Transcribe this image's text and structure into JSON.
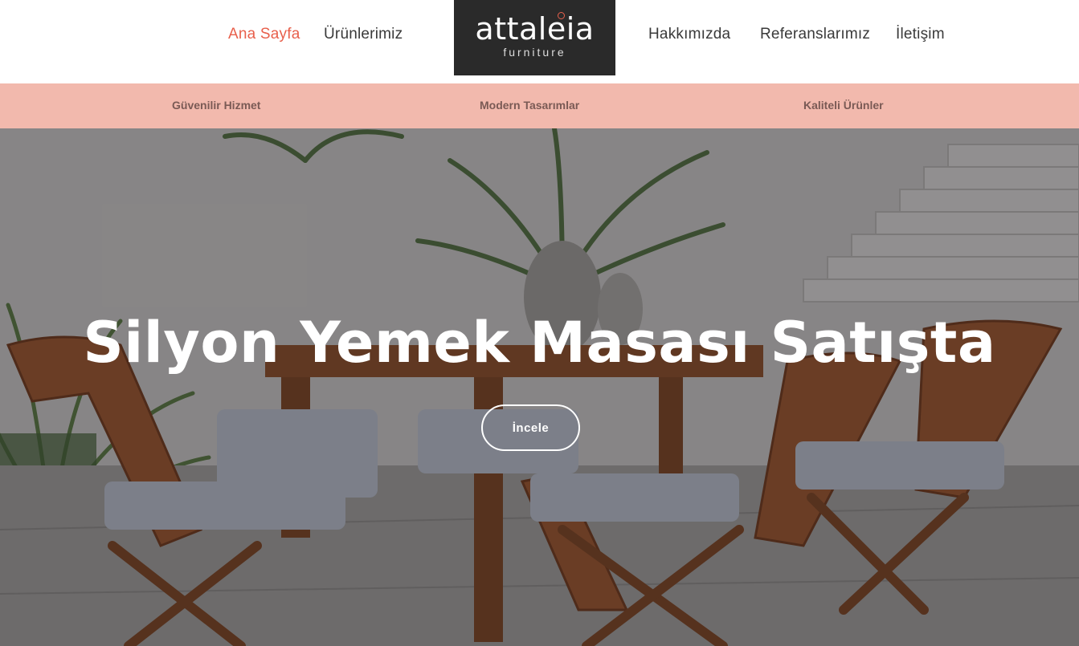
{
  "nav": {
    "left": [
      {
        "label": "Ana Sayfa",
        "active": true
      },
      {
        "label": "Ürünlerimiz",
        "active": false
      }
    ],
    "right": [
      {
        "label": "Hakkımızda"
      },
      {
        "label": "Referanslarımız"
      },
      {
        "label": "İletişim"
      }
    ]
  },
  "logo": {
    "word": "attaleia",
    "sub": "furniture"
  },
  "features": [
    "Güvenilir Hizmet",
    "Modern Tasarımlar",
    "Kaliteli Ürünler"
  ],
  "hero": {
    "title": "Silyon Yemek Masası Satışta",
    "button_label": "İncele"
  },
  "colors": {
    "accent": "#e8604c",
    "feature_bar": "#f2b9ad",
    "logo_bg": "#2a2a2a"
  }
}
